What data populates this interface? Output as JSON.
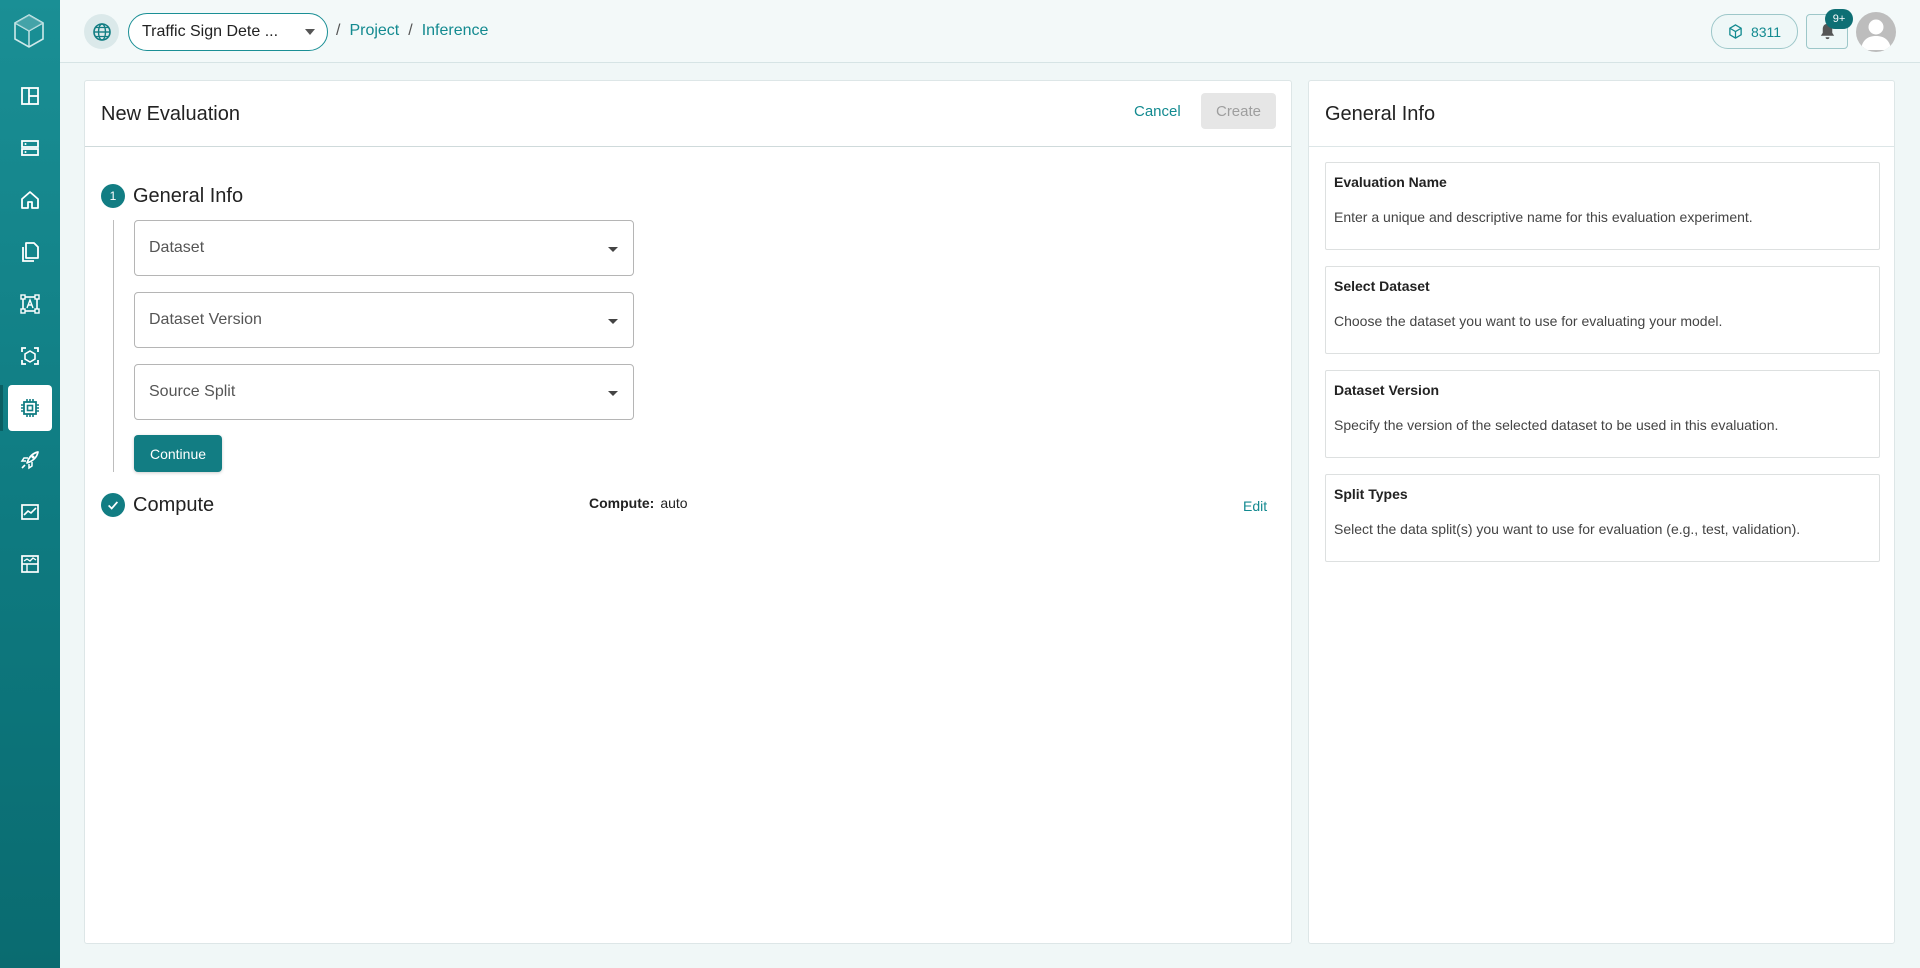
{
  "sidebar": {
    "items": [
      {
        "name": "dashboard",
        "icon": "layout-icon"
      },
      {
        "name": "datasets",
        "icon": "server-icon"
      },
      {
        "name": "home",
        "icon": "home-icon"
      },
      {
        "name": "files",
        "icon": "files-icon"
      },
      {
        "name": "annotate",
        "icon": "annotate-icon"
      },
      {
        "name": "models",
        "icon": "model-icon"
      },
      {
        "name": "inference",
        "icon": "chip-icon",
        "active": true
      },
      {
        "name": "deploy",
        "icon": "rocket-icon"
      },
      {
        "name": "monitoring",
        "icon": "chart-icon"
      },
      {
        "name": "reports",
        "icon": "table-icon"
      }
    ]
  },
  "header": {
    "project_name": "Traffic Sign Dete ...",
    "breadcrumbs": [
      "Project",
      "Inference"
    ],
    "separator": "/",
    "credits": "8311",
    "notifications_badge": "9+"
  },
  "evaluation": {
    "title": "New Evaluation",
    "cancel_label": "Cancel",
    "create_label": "Create",
    "step1": {
      "number": "1",
      "title": "General Info",
      "fields": {
        "dataset_placeholder": "Dataset",
        "dataset_version_placeholder": "Dataset Version",
        "source_split_placeholder": "Source Split"
      },
      "continue_label": "Continue"
    },
    "step2": {
      "title": "Compute",
      "compute_key": "Compute:",
      "compute_value": "auto",
      "edit_label": "Edit"
    }
  },
  "info_panel": {
    "title": "General Info",
    "cards": [
      {
        "title": "Evaluation Name",
        "text": "Enter a unique and descriptive name for this evaluation experiment."
      },
      {
        "title": "Select Dataset",
        "text": "Choose the dataset you want to use for evaluating your model."
      },
      {
        "title": "Dataset Version",
        "text": "Specify the version of the selected dataset to be used in this evaluation."
      },
      {
        "title": "Split Types",
        "text": "Select the data split(s) you want to use for evaluation (e.g., test, validation)."
      }
    ]
  },
  "colors": {
    "accent": "#127d83",
    "sidebar": "#0e7a80",
    "disabled": "#e6e6e6"
  }
}
